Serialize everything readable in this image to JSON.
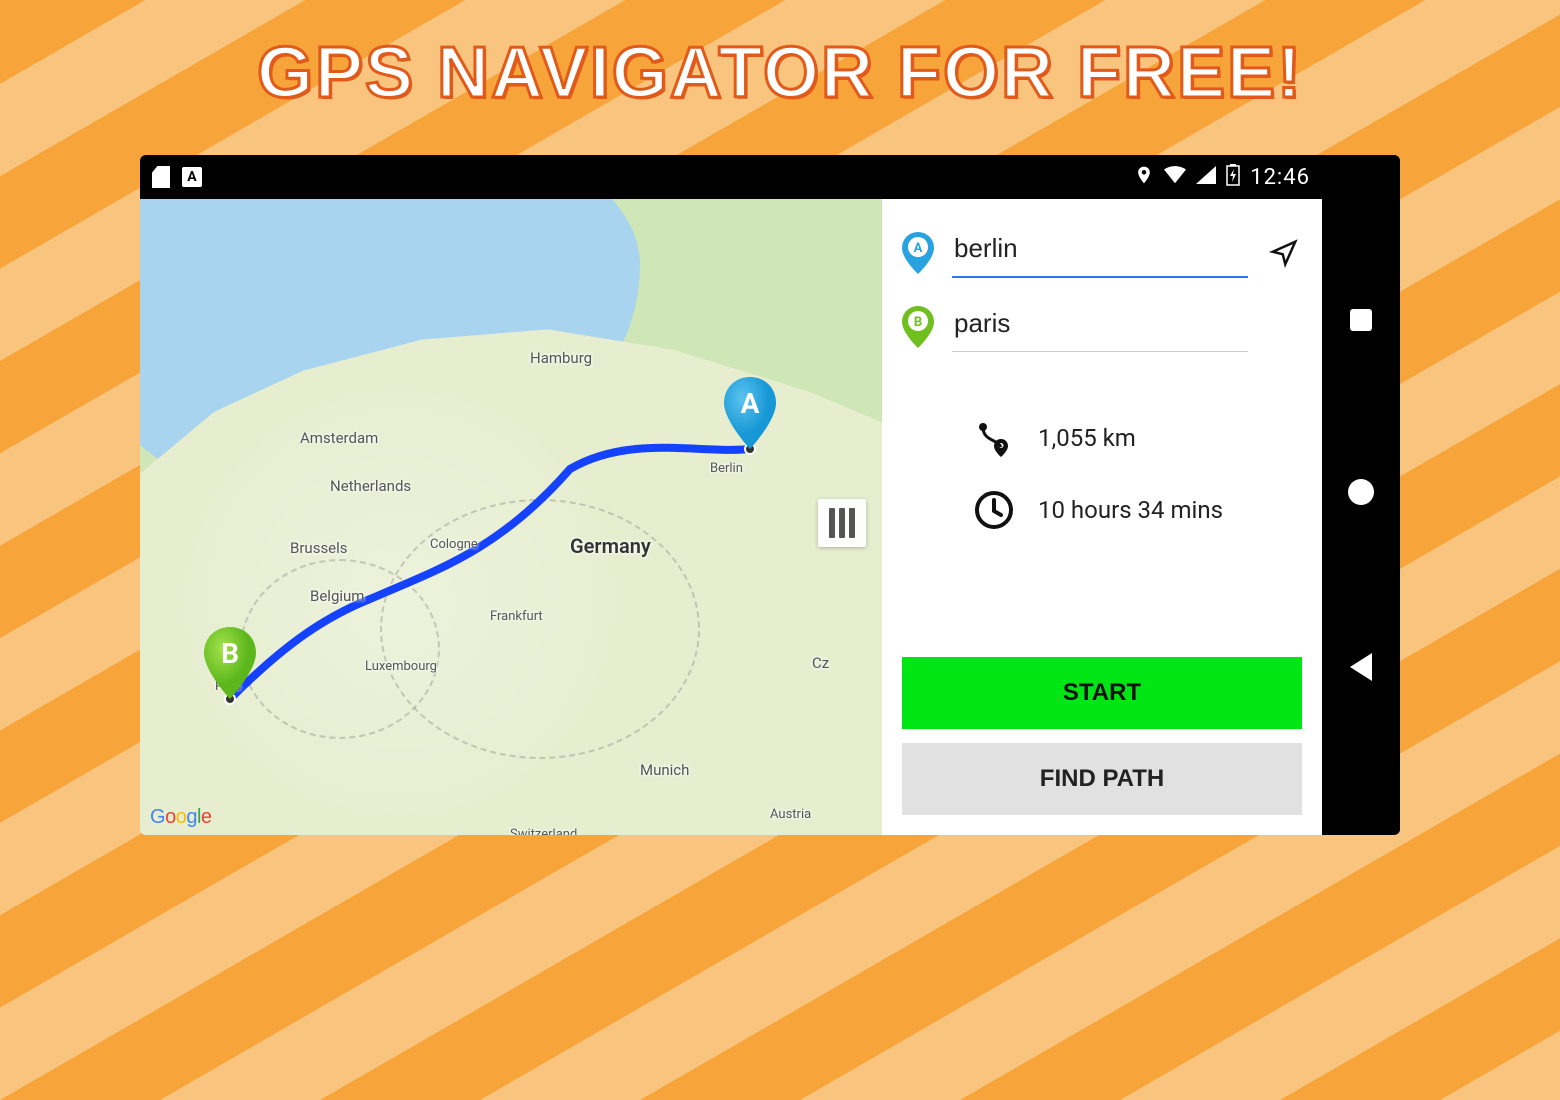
{
  "promo": {
    "title": "GPS NAVIGATOR FOR  FREE!"
  },
  "statusbar": {
    "clock": "12:46"
  },
  "map": {
    "attribution": "Google",
    "labels": {
      "hamburg": "Hamburg",
      "amsterdam": "Amsterdam",
      "netherlands": "Netherlands",
      "berlin": "Berlin",
      "brussels": "Brussels",
      "cologne": "Cologne",
      "germany": "Germany",
      "belgium": "Belgium",
      "frankfurt": "Frankfurt",
      "luxembourg": "Luxembourg",
      "cz": "Cz",
      "paris": "P...is",
      "munich": "Munich",
      "austria": "Austria",
      "switzerland": "Switzerland"
    },
    "markers": {
      "a": "A",
      "b": "B"
    }
  },
  "panel": {
    "origin": {
      "value": "berlin"
    },
    "destination": {
      "value": "paris"
    },
    "distance": "1,055 km",
    "duration": "10 hours 34 mins",
    "start_label": "START",
    "find_label": "FIND PATH"
  }
}
